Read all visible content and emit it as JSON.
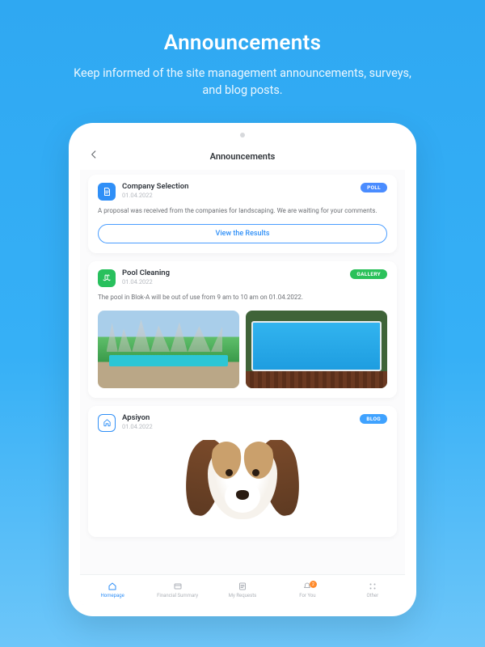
{
  "promo": {
    "title": "Announcements",
    "subtitle": "Keep informed of the site management announcements, surveys, and blog posts."
  },
  "app": {
    "screen_title": "Announcements"
  },
  "badges": {
    "poll": "POLL",
    "gallery": "GALLERY",
    "blog": "BLOG"
  },
  "posts": [
    {
      "icon": "document-icon",
      "icon_color": "#2f8ff7",
      "title": "Company Selection",
      "date": "01.04.2022",
      "badge": "poll",
      "body": "A proposal was received from the companies for landscaping. We are waiting for your comments.",
      "cta": "View the Results"
    },
    {
      "icon": "pool-icon",
      "icon_color": "#28c05d",
      "title": "Pool Cleaning",
      "date": "01.04.2022",
      "badge": "gallery",
      "body": "The pool in Blok-A will be out of use from 9 am to 10 am on 01.04.2022."
    },
    {
      "icon": "home-outline-icon",
      "icon_color": "#ffffff",
      "title": "Apsiyon",
      "date": "01.04.2022",
      "badge": "blog"
    }
  ],
  "tabs": [
    {
      "label": "Homepage",
      "icon": "home-icon"
    },
    {
      "label": "Financial Summary",
      "icon": "wallet-icon"
    },
    {
      "label": "My Requests",
      "icon": "list-icon"
    },
    {
      "label": "For You",
      "icon": "bell-icon",
      "badge": "2"
    },
    {
      "label": "Other",
      "icon": "grid-icon"
    }
  ]
}
